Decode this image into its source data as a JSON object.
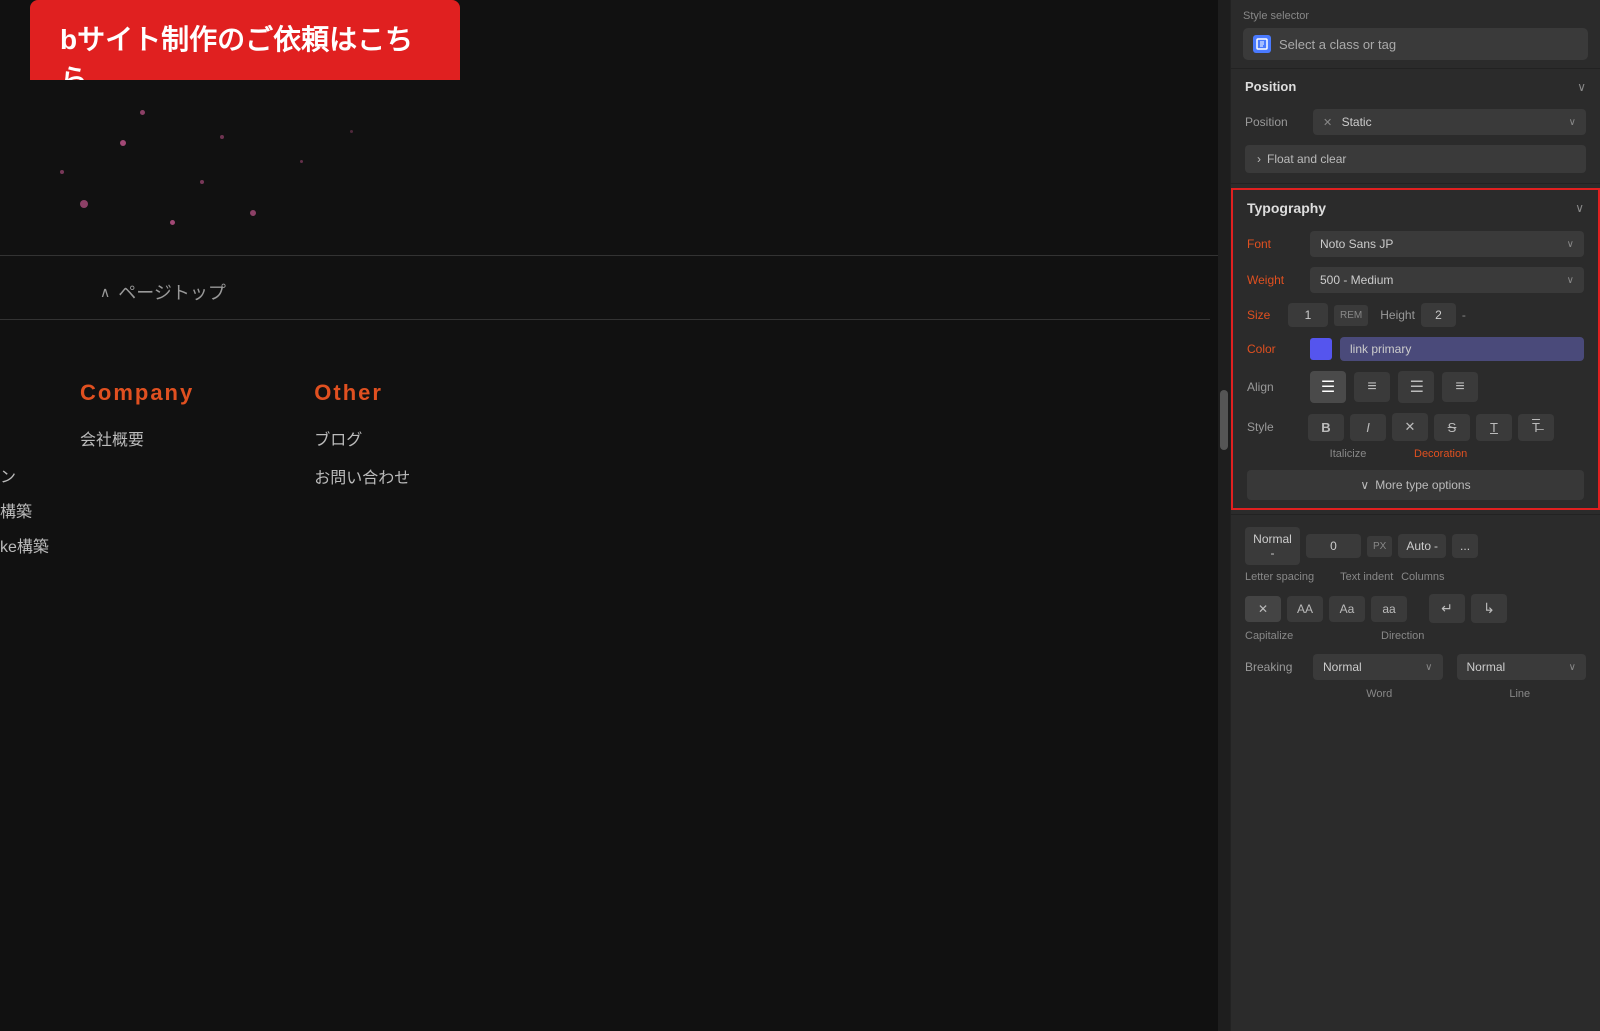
{
  "canvas": {
    "banner_text": "bサイト制作のご依頼はこちら",
    "page_top_label": "ページトップ",
    "footer_company_title": "Company",
    "footer_company_items": [
      "会社概要"
    ],
    "footer_other_title": "Other",
    "footer_other_items": [
      "ブログ",
      "お問い合わせ"
    ],
    "left_items": [
      "ン",
      "構築",
      "ke構築"
    ]
  },
  "right_panel": {
    "style_selector": {
      "section_label": "Style selector",
      "placeholder": "Select a class or tag",
      "icon_label": "selector-icon"
    },
    "position": {
      "section_title": "Position",
      "position_label": "Position",
      "position_value": "Static",
      "float_clear_label": "Float and clear",
      "float_clear_chevron": "›"
    },
    "typography": {
      "section_title": "Typography",
      "font_label": "Font",
      "font_value": "Noto Sans JP",
      "weight_label": "Weight",
      "weight_value": "500 - Medium",
      "size_label": "Size",
      "size_value": "1",
      "size_unit": "REM",
      "height_label": "Height",
      "height_value": "2",
      "height_dash": "-",
      "color_label": "Color",
      "color_value": "link primary",
      "align_label": "Align",
      "align_options": [
        "≡",
        "≡",
        "≡",
        "≡"
      ],
      "style_label": "Style",
      "style_buttons": [
        "B",
        "I",
        "✕",
        "S̶",
        "T̲",
        "T̶"
      ],
      "italicize_label": "Italicize",
      "decoration_label": "Decoration",
      "more_type_label": "More type options",
      "more_type_chevron": "∨"
    },
    "more_type": {
      "letter_spacing_value": "Normal",
      "letter_spacing_dash": "-",
      "letter_spacing_num": "0",
      "letter_spacing_unit": "PX",
      "text_indent_value": "Auto",
      "text_indent_dash": "-",
      "columns_more": "...",
      "letter_spacing_label": "Letter spacing",
      "text_indent_label": "Text indent",
      "columns_label": "Columns",
      "cap_x": "✕",
      "cap_aa": "AA",
      "cap_a": "Aa",
      "cap_lc": "aa",
      "dir_ltr": "↵",
      "dir_rtl": "↳",
      "capitalize_label": "Capitalize",
      "direction_label": "Direction",
      "breaking_label": "Breaking",
      "breaking_word_value": "Normal",
      "breaking_line_value": "Normal",
      "breaking_word_label": "Word",
      "breaking_line_label": "Line"
    }
  }
}
